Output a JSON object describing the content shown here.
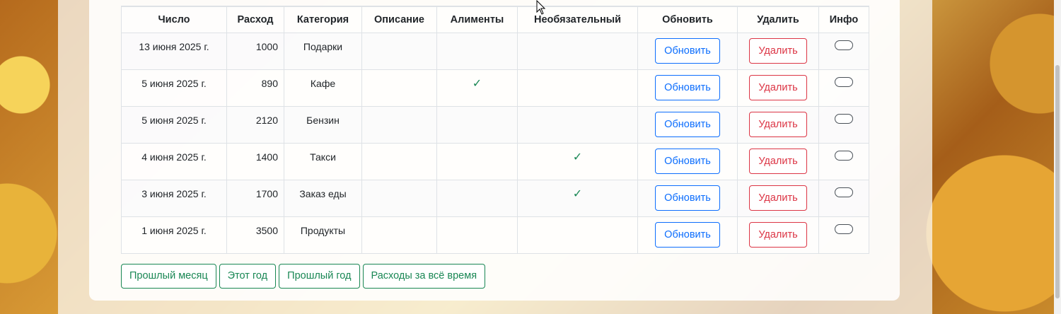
{
  "table": {
    "headers": [
      "Число",
      "Расход",
      "Категория",
      "Описание",
      "Алименты",
      "Необязательный",
      "Обновить",
      "Удалить",
      "Инфо"
    ],
    "update_label": "Обновить",
    "delete_label": "Удалить",
    "check_mark": "✓",
    "rows": [
      {
        "date": "13 июня 2025 г.",
        "amount": "1000",
        "category": "Подарки",
        "description": "",
        "alimony": false,
        "optional": false
      },
      {
        "date": "5 июня 2025 г.",
        "amount": "890",
        "category": "Кафе",
        "description": "",
        "alimony": true,
        "optional": false
      },
      {
        "date": "5 июня 2025 г.",
        "amount": "2120",
        "category": "Бензин",
        "description": "",
        "alimony": false,
        "optional": false
      },
      {
        "date": "4 июня 2025 г.",
        "amount": "1400",
        "category": "Такси",
        "description": "",
        "alimony": false,
        "optional": true
      },
      {
        "date": "3 июня 2025 г.",
        "amount": "1700",
        "category": "Заказ еды",
        "description": "",
        "alimony": false,
        "optional": true
      },
      {
        "date": "1 июня 2025 г.",
        "amount": "3500",
        "category": "Продукты",
        "description": "",
        "alimony": false,
        "optional": false
      }
    ]
  },
  "filters": {
    "last_month": "Прошлый месяц",
    "this_year": "Этот год",
    "last_year": "Прошлый год",
    "all_time": "Расходы за всё время"
  },
  "colors": {
    "primary": "#0d6efd",
    "danger": "#dc3545",
    "success": "#198754"
  }
}
